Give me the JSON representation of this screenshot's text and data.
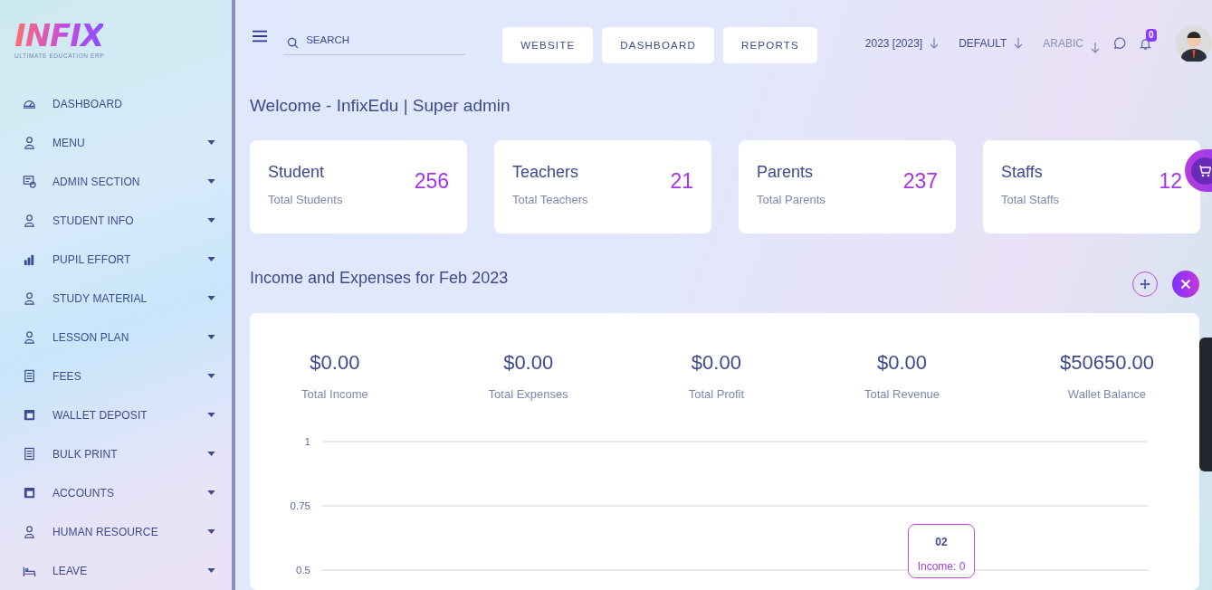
{
  "brand": {
    "logo": "INFIX",
    "tagline": "ULTIMATE EDUCATION ERP"
  },
  "sidebar": {
    "items": [
      {
        "label": "DASHBOARD",
        "has_submenu": false
      },
      {
        "label": "MENU",
        "has_submenu": true
      },
      {
        "label": "ADMIN SECTION",
        "has_submenu": true
      },
      {
        "label": "STUDENT INFO",
        "has_submenu": true
      },
      {
        "label": "PUPIL EFFORT",
        "has_submenu": true
      },
      {
        "label": "STUDY MATERIAL",
        "has_submenu": true
      },
      {
        "label": "LESSON PLAN",
        "has_submenu": true
      },
      {
        "label": "FEES",
        "has_submenu": true
      },
      {
        "label": "WALLET DEPOSIT",
        "has_submenu": true
      },
      {
        "label": "BULK PRINT",
        "has_submenu": true
      },
      {
        "label": "ACCOUNTS",
        "has_submenu": true
      },
      {
        "label": "HUMAN RESOURCE",
        "has_submenu": true
      },
      {
        "label": "LEAVE",
        "has_submenu": true
      }
    ]
  },
  "search": {
    "placeholder": "SEARCH"
  },
  "nav_buttons": [
    "WEBSITE",
    "DASHBOARD",
    "REPORTS"
  ],
  "selectors": [
    {
      "label": "2023 [2023]",
      "dimmed": false
    },
    {
      "label": "DEFAULT",
      "dimmed": false
    },
    {
      "label": "ARABIC",
      "dimmed": true
    }
  ],
  "notifications": {
    "count": "0"
  },
  "welcome": "Welcome - InfixEdu | Super admin",
  "stat_cards": [
    {
      "title": "Student",
      "subtitle": "Total Students",
      "value": "256"
    },
    {
      "title": "Teachers",
      "subtitle": "Total Teachers",
      "value": "21"
    },
    {
      "title": "Parents",
      "subtitle": "Total Parents",
      "value": "237"
    },
    {
      "title": "Staffs",
      "subtitle": "Total Staffs",
      "value": "12"
    }
  ],
  "finance": {
    "title": "Income and Expenses for Feb 2023",
    "totals": [
      {
        "amount": "$0.00",
        "label": "Total Income"
      },
      {
        "amount": "$0.00",
        "label": "Total Expenses"
      },
      {
        "amount": "$0.00",
        "label": "Total Profit"
      },
      {
        "amount": "$0.00",
        "label": "Total Revenue"
      },
      {
        "amount": "$50650.00",
        "label": "Wallet Balance"
      }
    ],
    "chart_grid_labels": [
      "1",
      "0.75",
      "0.5"
    ],
    "tooltip": {
      "title": "02",
      "text": "Income: 0"
    }
  }
}
